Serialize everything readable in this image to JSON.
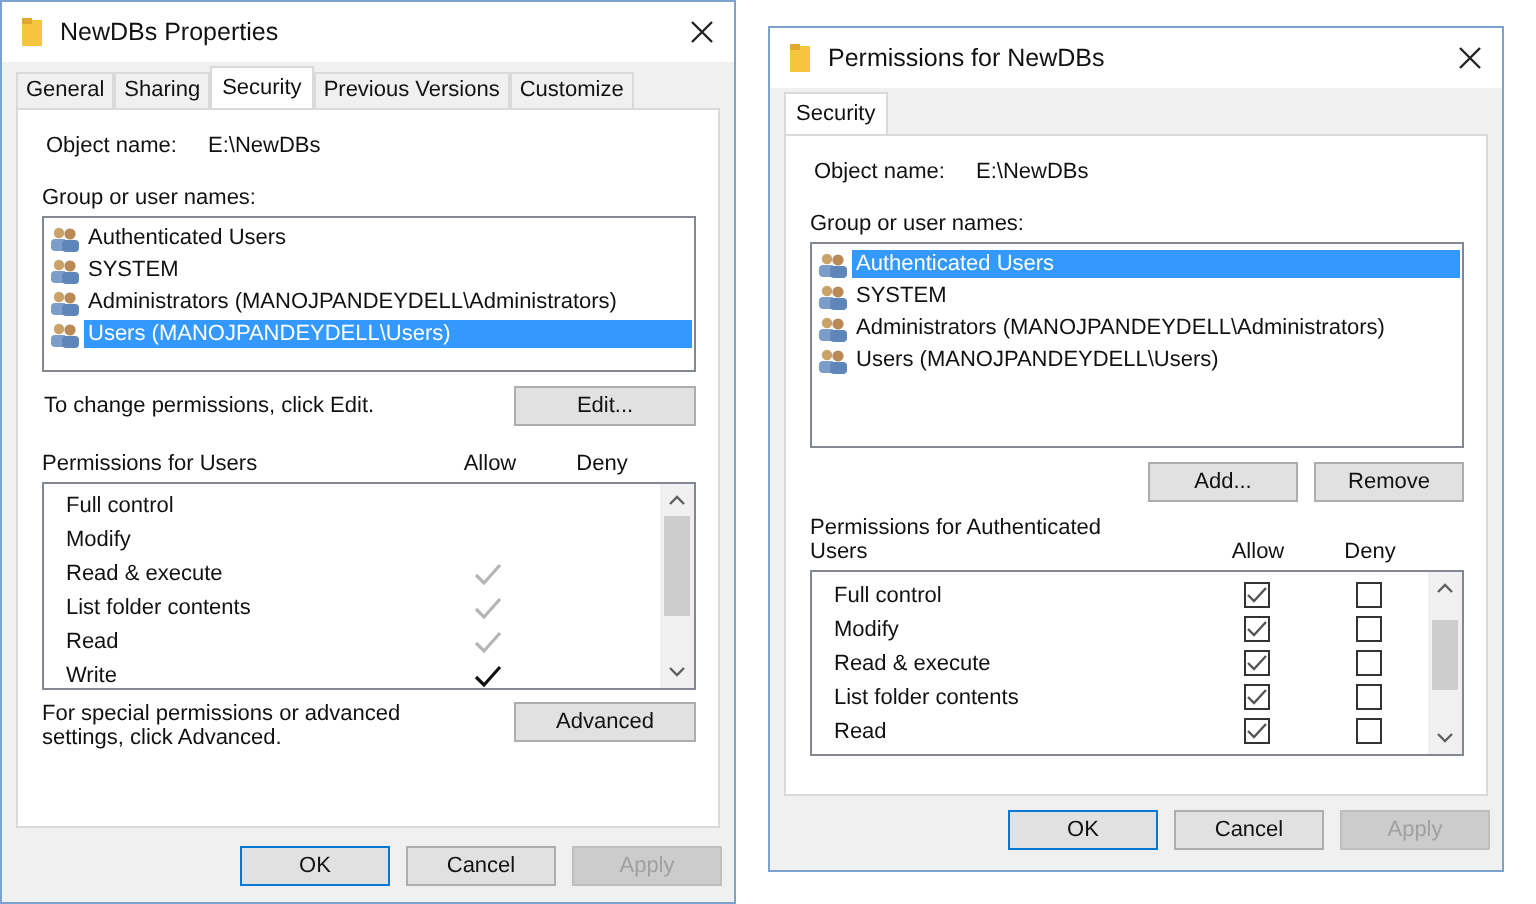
{
  "windows": [
    {
      "title": "NewDBs Properties",
      "tabs": [
        {
          "label": "General",
          "selected": false
        },
        {
          "label": "Sharing",
          "selected": false
        },
        {
          "label": "Security",
          "selected": true
        },
        {
          "label": "Previous Versions",
          "selected": false
        },
        {
          "label": "Customize",
          "selected": false
        }
      ],
      "object_name_label": "Object name:",
      "object_name": "E:\\NewDBs",
      "group_label": "Group or user names:",
      "groups": [
        {
          "name": "Authenticated Users",
          "selected": false
        },
        {
          "name": "SYSTEM",
          "selected": false
        },
        {
          "name": "Administrators (MANOJPANDEYDELL\\Administrators)",
          "selected": false
        },
        {
          "name": "Users (MANOJPANDEYDELL\\Users)",
          "selected": true
        }
      ],
      "edit_hint": "To change permissions, click Edit.",
      "group_buttons": [
        {
          "label": "Edit..."
        }
      ],
      "permissions_label": "Permissions for Users",
      "allow_header": "Allow",
      "deny_header": "Deny",
      "permissions": [
        {
          "kind": "mark",
          "name": "Full control",
          "allow": false
        },
        {
          "kind": "mark",
          "name": "Modify",
          "allow": false
        },
        {
          "kind": "mark",
          "name": "Read & execute",
          "allow": true,
          "inherited": true
        },
        {
          "kind": "mark",
          "name": "List folder contents",
          "allow": true,
          "inherited": true
        },
        {
          "kind": "mark",
          "name": "Read",
          "allow": true,
          "inherited": true
        },
        {
          "kind": "mark",
          "name": "Write",
          "allow": true,
          "inherited": false
        }
      ],
      "advanced_hint": "For special permissions or advanced settings, click Advanced.",
      "advanced_button": "Advanced",
      "buttons": [
        {
          "label": "OK",
          "default": true,
          "disabled": false
        },
        {
          "label": "Cancel",
          "default": false,
          "disabled": false
        },
        {
          "label": "Apply",
          "default": false,
          "disabled": true
        }
      ]
    },
    {
      "title": "Permissions for NewDBs",
      "tabs": [
        {
          "label": "Security",
          "selected": true
        }
      ],
      "object_name_label": "Object name:",
      "object_name": "E:\\NewDBs",
      "group_label": "Group or user names:",
      "groups": [
        {
          "name": "Authenticated Users",
          "selected": true
        },
        {
          "name": "SYSTEM",
          "selected": false
        },
        {
          "name": "Administrators (MANOJPANDEYDELL\\Administrators)",
          "selected": false
        },
        {
          "name": "Users (MANOJPANDEYDELL\\Users)",
          "selected": false
        }
      ],
      "group_buttons": [
        {
          "label": "Add..."
        },
        {
          "label": "Remove"
        }
      ],
      "permissions_label": "Permissions for Authenticated Users",
      "allow_header": "Allow",
      "deny_header": "Deny",
      "permissions": [
        {
          "kind": "checkbox",
          "name": "Full control",
          "allow": true,
          "deny": false
        },
        {
          "kind": "checkbox",
          "name": "Modify",
          "allow": true,
          "deny": false
        },
        {
          "kind": "checkbox",
          "name": "Read & execute",
          "allow": true,
          "deny": false
        },
        {
          "kind": "checkbox",
          "name": "List folder contents",
          "allow": true,
          "deny": false
        },
        {
          "kind": "checkbox",
          "name": "Read",
          "allow": true,
          "deny": false
        }
      ],
      "buttons": [
        {
          "label": "OK",
          "default": true,
          "disabled": false
        },
        {
          "label": "Cancel",
          "default": false,
          "disabled": false
        },
        {
          "label": "Apply",
          "default": false,
          "disabled": true
        }
      ]
    }
  ]
}
